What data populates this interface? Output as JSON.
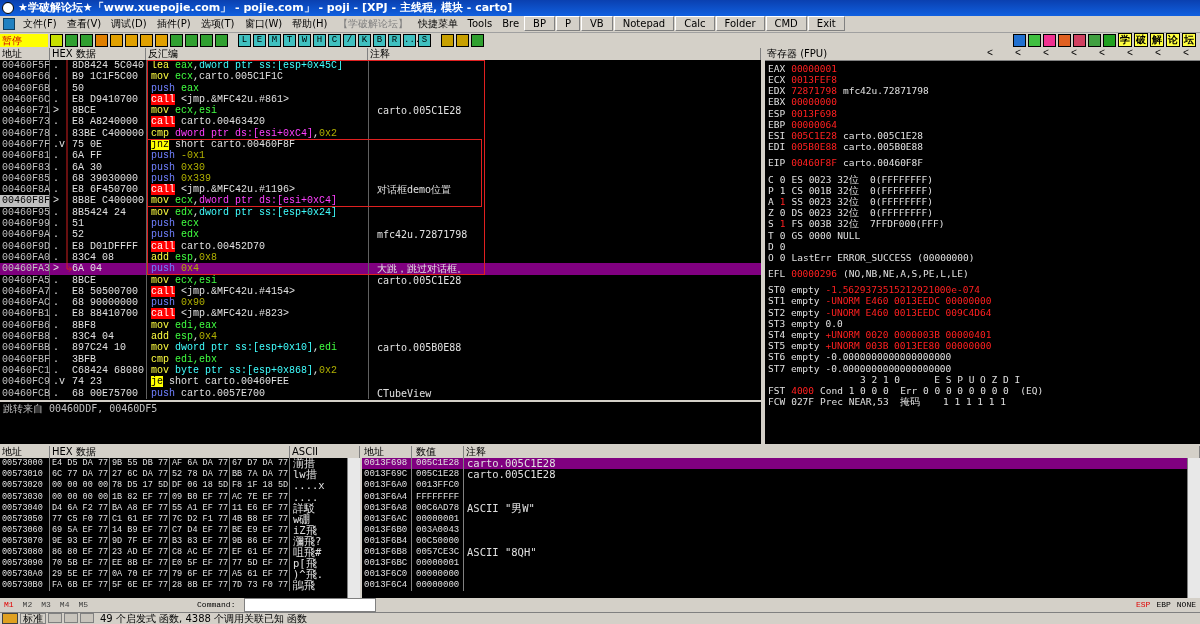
{
  "window": {
    "title": "★学破解论坛★「www.xuepojie.com」 - pojie.com」 - poji - [XPJ - 主线程, 模块 - carto]"
  },
  "menu": [
    {
      "label": "文件(F)",
      "kind": "menu"
    },
    {
      "label": "查看(V)",
      "kind": "menu"
    },
    {
      "label": "调试(D)",
      "kind": "menu"
    },
    {
      "label": "插件(P)",
      "kind": "menu"
    },
    {
      "label": "选项(T)",
      "kind": "menu"
    },
    {
      "label": "窗口(W)",
      "kind": "menu"
    },
    {
      "label": "帮助(H)",
      "kind": "menu"
    },
    {
      "label": "【学破解论坛】",
      "kind": "disabled"
    },
    {
      "label": "快捷菜单",
      "kind": "menu"
    },
    {
      "label": "Tools",
      "kind": "menu"
    },
    {
      "label": "Bre",
      "kind": "menu"
    },
    {
      "label": "BP",
      "kind": "button"
    },
    {
      "label": "P",
      "kind": "button"
    },
    {
      "label": "VB",
      "kind": "button"
    },
    {
      "label": "Notepad",
      "kind": "button"
    },
    {
      "label": "Calc",
      "kind": "button"
    },
    {
      "label": "Folder",
      "kind": "button"
    },
    {
      "label": "CMD",
      "kind": "button"
    },
    {
      "label": "Exit",
      "kind": "button"
    }
  ],
  "toolbar": {
    "status": "暂停",
    "letters": [
      "L",
      "E",
      "M",
      "T",
      "W",
      "H",
      "C",
      "/",
      "K",
      "B",
      "R",
      "...",
      "S"
    ],
    "forum_buttons": [
      "学",
      "破",
      "解",
      "论",
      "坛"
    ]
  },
  "disassembly": {
    "columns": [
      "地址",
      "HEX 数据",
      "反汇编",
      "注释"
    ],
    "rows": [
      {
        "addr": "00460F5F",
        "mark": ".",
        "hex": "8D8424 5C040",
        "asm": [
          {
            "kind": "op",
            "text": "lea"
          },
          {
            "kind": "reg",
            "text": " eax"
          },
          {
            "kind": "text",
            "text": ","
          },
          {
            "kind": "mem",
            "text": "dword ptr ss:[esp+0x45C]"
          }
        ],
        "comment": "",
        "selected": false,
        "current": false
      },
      {
        "addr": "00460F66",
        "mark": ".",
        "hex": "B9 1C1F5C00",
        "asm": [
          {
            "kind": "op",
            "text": "mov"
          },
          {
            "kind": "reg",
            "text": " ecx"
          },
          {
            "kind": "text",
            "text": ",carto.005C1F1C"
          }
        ],
        "comment": "",
        "selected": false,
        "current": false
      },
      {
        "addr": "00460F6B",
        "mark": ".",
        "hex": "50",
        "asm": [
          {
            "kind": "push",
            "text": "push"
          },
          {
            "kind": "reg",
            "text": " eax"
          }
        ],
        "comment": "",
        "selected": false,
        "current": false
      },
      {
        "addr": "00460F6C",
        "mark": ".",
        "hex": "E8 D9410700",
        "asm": [
          {
            "kind": "call",
            "text": "call"
          },
          {
            "kind": "text",
            "text": " <jmp.&MFC42u.#861>"
          }
        ],
        "comment": "",
        "selected": false,
        "current": false
      },
      {
        "addr": "00460F71",
        "mark": ">",
        "hex": "8BCE",
        "asm": [
          {
            "kind": "op",
            "text": "mov"
          },
          {
            "kind": "reg",
            "text": " ecx,esi"
          }
        ],
        "comment": "carto.005C1E28",
        "selected": false,
        "current": false
      },
      {
        "addr": "00460F73",
        "mark": ".",
        "hex": "E8 A8240000",
        "asm": [
          {
            "kind": "call",
            "text": "call"
          },
          {
            "kind": "text",
            "text": " carto.00463420"
          }
        ],
        "comment": "",
        "selected": false,
        "current": false
      },
      {
        "addr": "00460F78",
        "mark": ".",
        "hex": "83BE C400000",
        "asm": [
          {
            "kind": "op",
            "text": "cmp"
          },
          {
            "kind": "dsmem",
            "text": " dword ptr ds:[esi+0xC4]"
          },
          {
            "kind": "text",
            "text": ","
          },
          {
            "kind": "imm",
            "text": "0x2"
          }
        ],
        "comment": "",
        "selected": false,
        "current": false
      },
      {
        "addr": "00460F7F",
        "mark": ".v",
        "hex": "75 0E",
        "asm": [
          {
            "kind": "jcc",
            "text": "jnz"
          },
          {
            "kind": "text",
            "text": " short carto.00460F8F"
          }
        ],
        "comment": "",
        "selected": false,
        "current": false
      },
      {
        "addr": "00460F81",
        "mark": ".",
        "hex": "6A FF",
        "asm": [
          {
            "kind": "push",
            "text": "push"
          },
          {
            "kind": "imm",
            "text": " -0x1"
          }
        ],
        "comment": "",
        "selected": false,
        "current": false
      },
      {
        "addr": "00460F83",
        "mark": ".",
        "hex": "6A 30",
        "asm": [
          {
            "kind": "push",
            "text": "push"
          },
          {
            "kind": "imm",
            "text": " 0x30"
          }
        ],
        "comment": "",
        "selected": false,
        "current": false
      },
      {
        "addr": "00460F85",
        "mark": ".",
        "hex": "68 39030000",
        "asm": [
          {
            "kind": "push",
            "text": "push"
          },
          {
            "kind": "imm",
            "text": " 0x339"
          }
        ],
        "comment": "",
        "selected": false,
        "current": false
      },
      {
        "addr": "00460F8A",
        "mark": ".",
        "hex": "E8 6F450700",
        "asm": [
          {
            "kind": "call",
            "text": "call"
          },
          {
            "kind": "text",
            "text": " <jmp.&MFC42u.#1196>"
          }
        ],
        "comment": "对话框demo位置",
        "selected": false,
        "current": false
      },
      {
        "addr": "00460F8F",
        "mark": ">",
        "hex": "8B8E C400000",
        "asm": [
          {
            "kind": "op",
            "text": "mov"
          },
          {
            "kind": "reg",
            "text": " ecx"
          },
          {
            "kind": "text",
            "text": ","
          },
          {
            "kind": "dsmem",
            "text": "dword ptr ds:[esi+0xC4]"
          }
        ],
        "comment": "",
        "selected": false,
        "current": true
      },
      {
        "addr": "00460F95",
        "mark": ".",
        "hex": "8B5424 24",
        "asm": [
          {
            "kind": "op",
            "text": "mov"
          },
          {
            "kind": "reg",
            "text": " edx"
          },
          {
            "kind": "text",
            "text": ","
          },
          {
            "kind": "mem",
            "text": "dword ptr ss:[esp+0x24]"
          }
        ],
        "comment": "",
        "selected": false,
        "current": false
      },
      {
        "addr": "00460F99",
        "mark": ".",
        "hex": "51",
        "asm": [
          {
            "kind": "push",
            "text": "push"
          },
          {
            "kind": "reg",
            "text": " ecx"
          }
        ],
        "comment": "",
        "selected": false,
        "current": false
      },
      {
        "addr": "00460F9A",
        "mark": ".",
        "hex": "52",
        "asm": [
          {
            "kind": "push",
            "text": "push"
          },
          {
            "kind": "reg",
            "text": " edx"
          }
        ],
        "comment": "mfc42u.72871798",
        "selected": false,
        "current": false
      },
      {
        "addr": "00460F9D",
        "mark": ".",
        "hex": "E8 D01DFFFF",
        "asm": [
          {
            "kind": "call",
            "text": "call"
          },
          {
            "kind": "text",
            "text": " carto.00452D70"
          }
        ],
        "comment": "",
        "selected": false,
        "current": false
      },
      {
        "addr": "00460FA0",
        "mark": ".",
        "hex": "83C4 08",
        "asm": [
          {
            "kind": "op",
            "text": "add"
          },
          {
            "kind": "reg",
            "text": " esp"
          },
          {
            "kind": "text",
            "text": ","
          },
          {
            "kind": "imm",
            "text": "0x8"
          }
        ],
        "comment": "",
        "selected": false,
        "current": false
      },
      {
        "addr": "00460FA3",
        "mark": ">",
        "hex": "6A 04",
        "asm": [
          {
            "kind": "push",
            "text": "push"
          },
          {
            "kind": "imm",
            "text": " 0x4"
          }
        ],
        "comment": "大跳，跳过对话框。",
        "selected": true,
        "current": false
      },
      {
        "addr": "00460FA5",
        "mark": ".",
        "hex": "8BCE",
        "asm": [
          {
            "kind": "op",
            "text": "mov"
          },
          {
            "kind": "reg",
            "text": " ecx,esi"
          }
        ],
        "comment": "carto.005C1E28",
        "selected": false,
        "current": false
      },
      {
        "addr": "00460FA7",
        "mark": ".",
        "hex": "E8 50500700",
        "asm": [
          {
            "kind": "call",
            "text": "call"
          },
          {
            "kind": "text",
            "text": " <jmp.&MFC42u.#4154>"
          }
        ],
        "comment": "",
        "selected": false,
        "current": false
      },
      {
        "addr": "00460FAC",
        "mark": ".",
        "hex": "68 90000000",
        "asm": [
          {
            "kind": "push",
            "text": "push"
          },
          {
            "kind": "imm",
            "text": " 0x90"
          }
        ],
        "comment": "",
        "selected": false,
        "current": false
      },
      {
        "addr": "00460FB1",
        "mark": ".",
        "hex": "E8 88410700",
        "asm": [
          {
            "kind": "call",
            "text": "call"
          },
          {
            "kind": "text",
            "text": " <jmp.&MFC42u.#823>"
          }
        ],
        "comment": "",
        "selected": false,
        "current": false
      },
      {
        "addr": "00460FB6",
        "mark": ".",
        "hex": "8BF8",
        "asm": [
          {
            "kind": "op",
            "text": "mov"
          },
          {
            "kind": "reg",
            "text": " edi,eax"
          }
        ],
        "comment": "",
        "selected": false,
        "current": false
      },
      {
        "addr": "00460FB8",
        "mark": ".",
        "hex": "83C4 04",
        "asm": [
          {
            "kind": "op",
            "text": "add"
          },
          {
            "kind": "reg",
            "text": " esp"
          },
          {
            "kind": "text",
            "text": ","
          },
          {
            "kind": "imm",
            "text": "0x4"
          }
        ],
        "comment": "",
        "selected": false,
        "current": false
      },
      {
        "addr": "00460FBB",
        "mark": ".",
        "hex": "897C24 10",
        "asm": [
          {
            "kind": "op",
            "text": "mov"
          },
          {
            "kind": "mem",
            "text": " dword ptr ss:[esp+0x10]"
          },
          {
            "kind": "text",
            "text": ","
          },
          {
            "kind": "reg",
            "text": "edi"
          }
        ],
        "comment": "carto.005B0E88",
        "selected": false,
        "current": false
      },
      {
        "addr": "00460FBF",
        "mark": ".",
        "hex": "3BFB",
        "asm": [
          {
            "kind": "op",
            "text": "cmp"
          },
          {
            "kind": "reg",
            "text": " edi,ebx"
          }
        ],
        "comment": "",
        "selected": false,
        "current": false
      },
      {
        "addr": "00460FC1",
        "mark": ".",
        "hex": "C68424 68080",
        "asm": [
          {
            "kind": "op",
            "text": "mov"
          },
          {
            "kind": "mem",
            "text": " byte ptr ss:[esp+0x868]"
          },
          {
            "kind": "text",
            "text": ","
          },
          {
            "kind": "imm",
            "text": "0x2"
          }
        ],
        "comment": "",
        "selected": false,
        "current": false
      },
      {
        "addr": "00460FC9",
        "mark": ".v",
        "hex": "74 23",
        "asm": [
          {
            "kind": "jcc",
            "text": "je"
          },
          {
            "kind": "text",
            "text": " short carto.00460FEE"
          }
        ],
        "comment": "",
        "selected": false,
        "current": false
      },
      {
        "addr": "00460FCB",
        "mark": ".",
        "hex": "68 00E75700",
        "asm": [
          {
            "kind": "push",
            "text": "push"
          },
          {
            "kind": "text",
            "text": " carto.0057E700"
          }
        ],
        "comment": "CTubeView",
        "selected": false,
        "current": false
      }
    ],
    "info": "跳转来自 00460DDF, 00460DF5"
  },
  "registers": {
    "title": "寄存器 (FPU)",
    "arrows": [
      "<",
      "<",
      "<",
      "<",
      "<",
      "<",
      "<",
      "<"
    ],
    "groups": [
      [
        {
          "name": "EAX",
          "value": "00000001",
          "changed": true
        },
        {
          "name": "ECX",
          "value": "0013FEF8",
          "changed": true
        },
        {
          "name": "EDX",
          "value": "72871798",
          "changed": true,
          "comment": "mfc42u.72871798"
        },
        {
          "name": "EBX",
          "value": "00000000",
          "changed": true
        },
        {
          "name": "ESP",
          "value": "0013F698",
          "changed": true
        },
        {
          "name": "EBP",
          "value": "00000064",
          "changed": true
        },
        {
          "name": "ESI",
          "value": "005C1E28",
          "changed": true,
          "comment": "carto.005C1E28"
        },
        {
          "name": "EDI",
          "value": "005B0E88",
          "changed": true,
          "comment": "carto.005B0E88"
        }
      ],
      [
        {
          "name": "EIP",
          "value": "00460F8F",
          "changed": true,
          "comment": "carto.00460F8F"
        }
      ],
      [
        {
          "name": "C",
          "value": "0",
          "changed": false,
          "comment": "ES 0023 32位  0(FFFFFFFF)"
        },
        {
          "name": "P",
          "value": "1",
          "changed": false,
          "comment": "CS 001B 32位  0(FFFFFFFF)"
        },
        {
          "name": "A",
          "value": "1",
          "changed": true,
          "comment": "SS 0023 32位  0(FFFFFFFF)"
        },
        {
          "name": "Z",
          "value": "0",
          "changed": false,
          "comment": "DS 0023 32位  0(FFFFFFFF)"
        },
        {
          "name": "S",
          "value": "1",
          "changed": true,
          "comment": "FS 003B 32位  7FFDF000(FFF)"
        },
        {
          "name": "T",
          "value": "0",
          "changed": false,
          "comment": "GS 0000 NULL"
        },
        {
          "name": "D",
          "value": "0",
          "changed": false
        },
        {
          "name": "O",
          "value": "0",
          "changed": false,
          "comment": "LastErr ERROR_SUCCESS (00000000)"
        }
      ],
      [
        {
          "name": "EFL",
          "value": "00000296",
          "changed": true,
          "comment": "(NO,NB,NE,A,S,PE,L,LE)"
        }
      ],
      [
        {
          "name": "ST0 empty",
          "value": "-1.5629373515212921000e-074",
          "changed": true
        },
        {
          "name": "ST1 empty",
          "value": "-UNORM E460 0013EEDC 00000000",
          "changed": true
        },
        {
          "name": "ST2 empty",
          "value": "-UNORM E460 0013EEDC 009C4D64",
          "changed": true
        },
        {
          "name": "ST3 empty",
          "value": "0.0",
          "changed": false
        },
        {
          "name": "ST4 empty",
          "value": "+UNORM 0020 0000003B 00000401",
          "changed": true
        },
        {
          "name": "ST5 empty",
          "value": "+UNORM 003B 0013EE80 00000000",
          "changed": true
        },
        {
          "name": "ST6 empty",
          "value": "-0.0000000000000000000",
          "changed": false
        },
        {
          "name": "ST7 empty",
          "value": "-0.0000000000000000000",
          "changed": false
        },
        {
          "value": "3 2 1 0      E S P U O Z D I",
          "changed": false
        },
        {
          "name": "FST",
          "value": "4000",
          "changed": true,
          "comment": "Cond 1 0 0 0  Err 0 0 0 0 0 0 0 0  (EQ)"
        },
        {
          "name": "FCW",
          "value": "027F",
          "changed": false,
          "comment": "Prec NEAR,53  掩码    1 1 1 1 1 1"
        }
      ]
    ]
  },
  "dump": {
    "columns": [
      "地址",
      "HEX 数据",
      "ASCII"
    ],
    "rows": [
      {
        "addr": "00573000",
        "hex": [
          "E4 D5 DA 77",
          "9B 55 DB 77",
          "AF 6A DA 77",
          "67 D7 DA 77"
        ],
        "ascii": "湔措"
      },
      {
        "addr": "00573010",
        "hex": [
          "6C 77 DA 77",
          "27 6C DA 77",
          "52 78 DA 77",
          "BB 7A DA 77"
        ],
        "ascii": "lw措"
      },
      {
        "addr": "00573020",
        "hex": [
          "00 00 00 00",
          "78 D5 17 5D",
          "DF 06 18 5D",
          "F8 1F 18 5D"
        ],
        "ascii": "....x"
      },
      {
        "addr": "00573030",
        "hex": [
          "00 00 00 00",
          "1B 82 EF 77",
          "09 B0 EF 77",
          "AC 7E EF 77"
        ],
        "ascii": "...."
      },
      {
        "addr": "00573040",
        "hex": [
          "D4 6A F2 77",
          "BA A8 EF 77",
          "55 A1 EF 77",
          "11 E6 EF 77"
        ],
        "ascii": "詳駁"
      },
      {
        "addr": "00573050",
        "hex": [
          "77 C5 F0 77",
          "C1 61 EF 77",
          "7C D2 F1 77",
          "4B B8 EF 77"
        ],
        "ascii": "w硼"
      },
      {
        "addr": "00573060",
        "hex": [
          "69 5A EF 77",
          "14 B9 EF 77",
          "C7 D4 EF 77",
          "BE E9 EF 77"
        ],
        "ascii": "iZ飛"
      },
      {
        "addr": "00573070",
        "hex": [
          "9E 93 EF 77",
          "9D 7F EF 77",
          "B3 83 EF 77",
          "9B 86 EF 77"
        ],
        "ascii": "瀰飛?"
      },
      {
        "addr": "00573080",
        "hex": [
          "86 80 EF 77",
          "23 AD EF 77",
          "C8 AC EF 77",
          "EF 61 EF 77"
        ],
        "ascii": "咀飛#"
      },
      {
        "addr": "00573090",
        "hex": [
          "70 5B EF 77",
          "EE 8B EF 77",
          "E0 5F EF 77",
          "77 5D EF 77"
        ],
        "ascii": "p[飛"
      },
      {
        "addr": "005730A0",
        "hex": [
          "29 5E EF 77",
          "0A 70 EF 77",
          "79 6F EF 77",
          "A5 61 EF 77"
        ],
        "ascii": ")^飛."
      },
      {
        "addr": "005730B0",
        "hex": [
          "FA 6B EF 77",
          "5F 6E EF 77",
          "28 8B EF 77",
          "7D 73 F0 77"
        ],
        "ascii": "鵑飛"
      }
    ]
  },
  "stack": {
    "columns": [
      "地址",
      "数值",
      "注释"
    ],
    "rows": [
      {
        "addr": "0013F698",
        "value": "005C1E28",
        "comment": "carto.005C1E28",
        "selected": true
      },
      {
        "addr": "0013F69C",
        "value": "005C1E28",
        "comment": "carto.005C1E28",
        "selected": false
      },
      {
        "addr": "0013F6A0",
        "value": "0013FFC0",
        "comment": "",
        "selected": false
      },
      {
        "addr": "0013F6A4",
        "value": "FFFFFFFF",
        "comment": "",
        "selected": false
      },
      {
        "addr": "0013F6A8",
        "value": "00C6AD78",
        "comment": "ASCII \"男W\"",
        "selected": false
      },
      {
        "addr": "0013F6AC",
        "value": "00000001",
        "comment": "",
        "selected": false
      },
      {
        "addr": "0013F6B0",
        "value": "003A0043",
        "comment": "",
        "selected": false
      },
      {
        "addr": "0013F6B4",
        "value": "00C50000",
        "comment": "",
        "selected": false
      },
      {
        "addr": "0013F6B8",
        "value": "0057CE3C",
        "comment": "ASCII \"8QH\"",
        "selected": false
      },
      {
        "addr": "0013F6BC",
        "value": "00000001",
        "comment": "",
        "selected": false
      },
      {
        "addr": "0013F6C0",
        "value": "00000000",
        "comment": "",
        "selected": false
      },
      {
        "addr": "0013F6C4",
        "value": "00000000",
        "comment": "",
        "selected": false
      }
    ],
    "modes": [
      {
        "label": "ESP",
        "selected": true
      },
      {
        "label": "EBP",
        "selected": false
      },
      {
        "label": "NONE",
        "selected": false
      }
    ]
  },
  "dump_tabs": [
    {
      "label": "M1",
      "selected": true
    },
    {
      "label": "M2",
      "selected": false
    },
    {
      "label": "M3",
      "selected": false
    },
    {
      "label": "M4",
      "selected": false
    },
    {
      "label": "M5",
      "selected": false
    }
  ],
  "command": {
    "label": "Command:"
  },
  "status_bar": {
    "mode": "标准",
    "text": "49 个启发式 函数, 4388 个调用关联已知 函数"
  }
}
